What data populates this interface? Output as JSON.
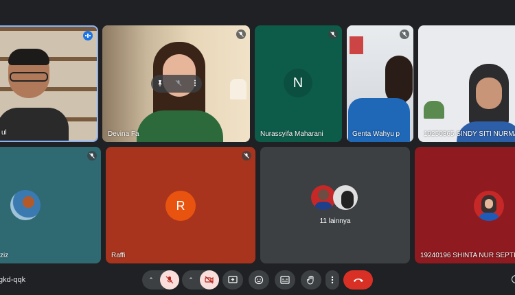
{
  "tiles": {
    "t1": {
      "name": "ul"
    },
    "t2": {
      "name": "Devina Fa"
    },
    "t3": {
      "name": "Nurassyifa Maharani",
      "initial": "N"
    },
    "t4": {
      "name": "Genta Wahyu p"
    },
    "t5": {
      "name": "19250365 SINDY SITI NURMARI"
    },
    "t6": {
      "name": "ziz"
    },
    "t7": {
      "name": "Raffi",
      "initial": "R"
    },
    "t8": {
      "others_label": "11 lainnya"
    },
    "t9": {
      "name": "19240196 SHINTA NUR SEPTI"
    }
  },
  "meeting": {
    "code": "gkd-qqk"
  },
  "colors": {
    "background": "#202124",
    "tile_green": "#0d5c4a",
    "tile_teal": "#2f6a73",
    "tile_red": "#a8341d",
    "tile_gray": "#3c4043",
    "tile_crimson": "#8f1a1f",
    "end_call": "#d93025"
  },
  "icons": [
    "mic-off-icon",
    "camera-off-icon",
    "chevron-up-icon",
    "present-icon",
    "emoji-icon",
    "captions-icon",
    "raise-hand-icon",
    "more-vert-icon",
    "end-call-icon",
    "pin-icon"
  ]
}
